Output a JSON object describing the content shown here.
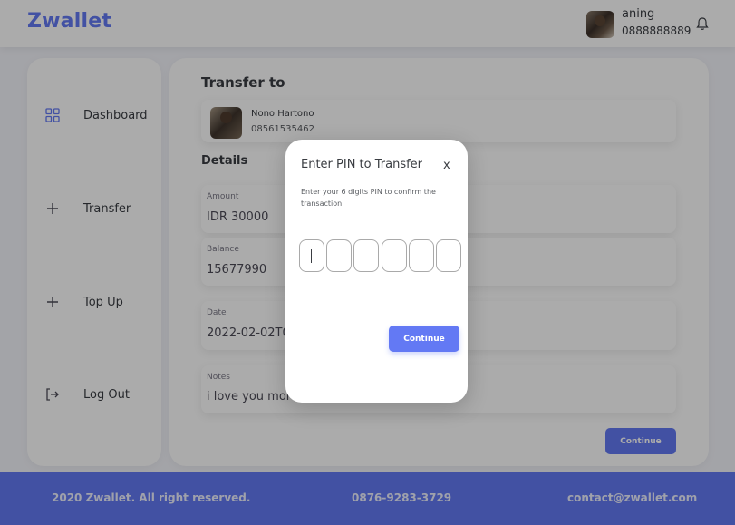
{
  "header": {
    "brand": "Zwallet",
    "user_name": "aning",
    "user_phone": "0888888889",
    "avatar_icon": "user-avatar",
    "bell_icon": "bell-icon"
  },
  "sidebar": {
    "items": [
      {
        "label": "Dashboard",
        "icon": "grid-icon"
      },
      {
        "label": "Transfer",
        "icon": "plus-icon"
      },
      {
        "label": "Top Up",
        "icon": "plus-icon"
      },
      {
        "label": "Log Out",
        "icon": "logout-icon"
      }
    ]
  },
  "main": {
    "transfer_to_title": "Transfer to",
    "recipient": {
      "name": "Nono Hartono",
      "phone": "08561535462"
    },
    "details_title": "Details",
    "fields": [
      {
        "label": "Amount",
        "value": "IDR 30000"
      },
      {
        "label": "Balance",
        "value": "15677990"
      },
      {
        "label": "Date",
        "value": "2022-02-02T0"
      },
      {
        "label": "Notes",
        "value": "i love you more"
      }
    ],
    "continue_label": "Continue"
  },
  "modal": {
    "title": "Enter PIN to Transfer",
    "close_label": "x",
    "description": "Enter your 6 digits PIN to confirm the transaction",
    "pin_length": 6,
    "continue_label": "Continue"
  },
  "footer": {
    "copyright": "2020 Zwallet. All right reserved.",
    "phone": "0876-9283-3729",
    "email": "contact@zwallet.com"
  },
  "colors": {
    "accent": "#6379f4",
    "background": "#f4f5fb",
    "overlay": "rgba(0,0,0,0.33)"
  }
}
